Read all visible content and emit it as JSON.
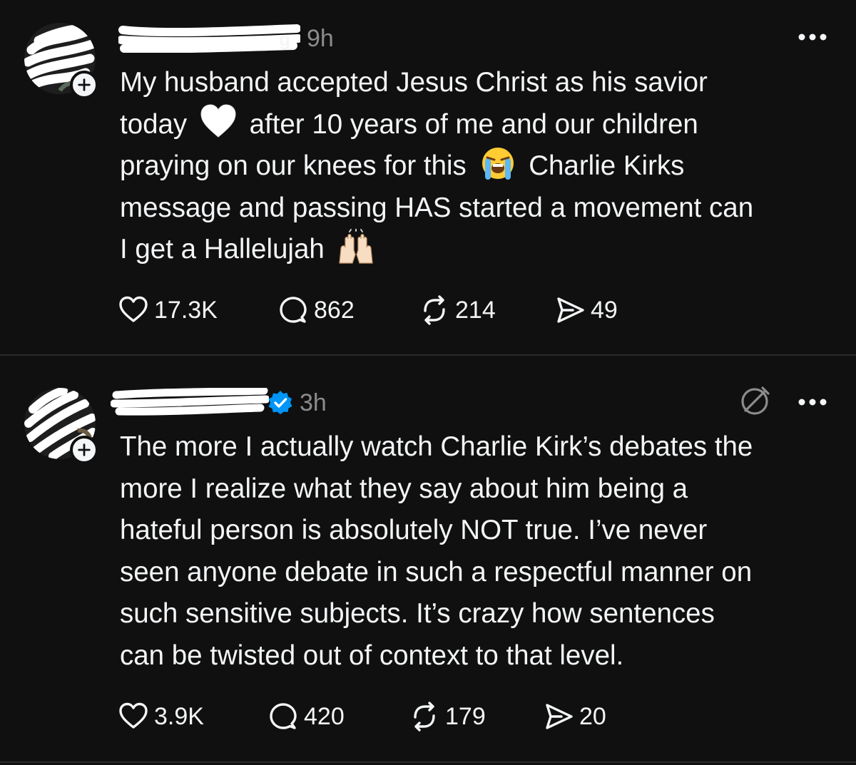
{
  "posts": [
    {
      "time": "9h",
      "verified": false,
      "lines": [
        [
          "My husband accepted Jesus Christ as his savior"
        ],
        [
          "today ",
          {
            "emoji": "white-heart-icon"
          },
          " after 10 years of me and our children"
        ],
        [
          "praying on our knees for this ",
          {
            "emoji": "loudly-crying-face-icon"
          },
          " Charlie Kirks"
        ],
        [
          "message and passing HAS started a movement can"
        ],
        [
          "I get a Hallelujah ",
          {
            "emoji": "raising-hands-icon"
          }
        ]
      ],
      "stats": {
        "likes": "17.3K",
        "replies": "862",
        "reposts": "214",
        "shares": "49"
      }
    },
    {
      "time": "3h",
      "verified": true,
      "lines": [
        [
          "The more I actually watch Charlie Kirk’s debates the"
        ],
        [
          "more I realize what they say about him being a"
        ],
        [
          "hateful person is absolutely NOT true. I’ve never"
        ],
        [
          "seen anyone debate in such a respectful manner on"
        ],
        [
          "such sensitive subjects. It’s crazy how sentences"
        ],
        [
          "can be twisted out of context to that level."
        ]
      ],
      "stats": {
        "likes": "3.9K",
        "replies": "420",
        "reposts": "179",
        "shares": "20"
      }
    }
  ],
  "colors": {
    "background": "#101010",
    "text": "#f3f5f7",
    "secondary_text": "#8c8c8c",
    "divider": "#2a2a2a",
    "verified_blue": "#0095f6"
  },
  "icons": {
    "like": "heart-icon",
    "reply": "reply-bubble-icon",
    "repost": "repost-icon",
    "share": "share-send-icon",
    "more": "more-options-icon",
    "mute": "mute-icon",
    "follow": "plus-icon",
    "verified": "verified-badge-icon"
  }
}
